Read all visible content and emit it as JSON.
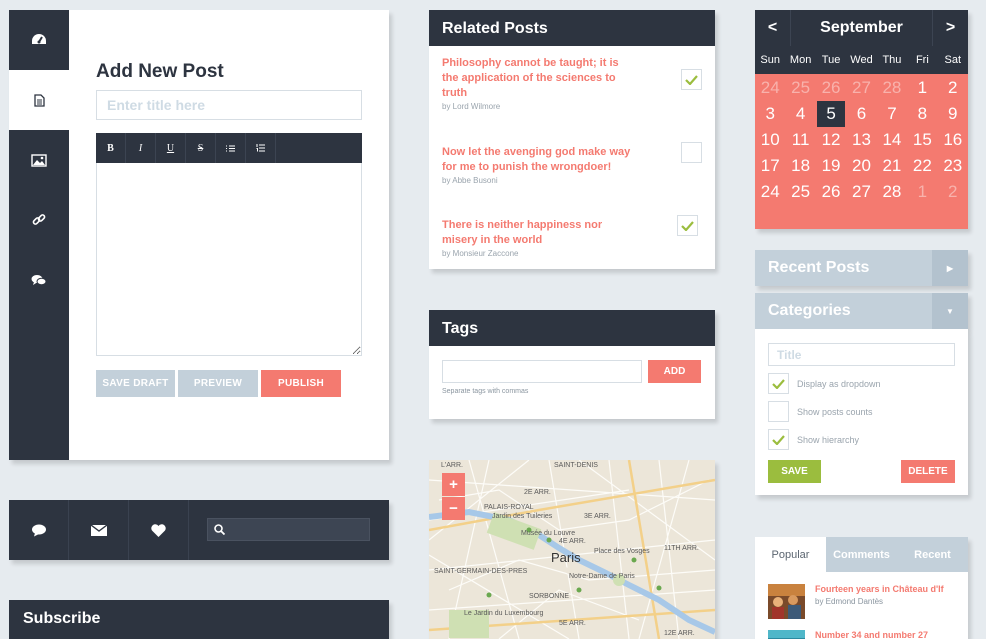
{
  "editor": {
    "title": "Add New Post",
    "title_placeholder": "Enter title here",
    "toolbar": [
      "B",
      "I",
      "U",
      "S",
      "ul",
      "ol"
    ],
    "save_draft": "SAVE DRAFT",
    "preview": "PREVIEW",
    "publish": "PUBLISH",
    "sidebar_icons": [
      "dashboard-icon",
      "document-icon",
      "image-icon",
      "link-icon",
      "comments-icon"
    ]
  },
  "social": {
    "icons": [
      "chat-icon",
      "mail-icon",
      "heart-icon"
    ],
    "search_placeholder": ""
  },
  "subscribe": {
    "title": "Subscribe"
  },
  "related": {
    "title": "Related Posts",
    "items": [
      {
        "title": "Philosophy cannot be taught; it is the application of the sciences to truth",
        "author": "by Lord Wilmore",
        "checked": true
      },
      {
        "title": "Now let the avenging god make way for me to punish the wrongdoer!",
        "author": "by Abbe Busoni",
        "checked": false
      },
      {
        "title": "There is neither happiness nor misery in the world",
        "author": "by Monsieur Zaccone",
        "checked": true
      }
    ]
  },
  "tags": {
    "title": "Tags",
    "add": "ADD",
    "hint": "Separate tags with commas"
  },
  "map": {
    "zoom_in": "+",
    "zoom_out": "−",
    "labels": {
      "paris": "Paris",
      "l1": "L'ARR.",
      "l2": "SAINT-DENIS",
      "l3": "2E ARR.",
      "l4": "PALAIS-ROYAL",
      "l5": "Jardin des Tuileries",
      "l6": "3E ARR.",
      "l7": "Musée du Louvre",
      "l8": "Place des Vosges",
      "l9": "4E ARR.",
      "l10": "11TH ARR.",
      "l11": "SAINT-GERMAIN-DES-PRES",
      "l12": "Notre-Dame de Paris",
      "l13": "SORBONNE",
      "l14": "Le Jardin du Luxembourg",
      "l15": "5E ARR.",
      "l16": "12E ARR."
    }
  },
  "calendar": {
    "prev": "<",
    "next": ">",
    "month": "September",
    "days": [
      "Sun",
      "Mon",
      "Tue",
      "Wed",
      "Thu",
      "Fri",
      "Sat"
    ],
    "cells": [
      {
        "d": "24",
        "m": true
      },
      {
        "d": "25",
        "m": true
      },
      {
        "d": "26",
        "m": true
      },
      {
        "d": "27",
        "m": true
      },
      {
        "d": "28",
        "m": true
      },
      {
        "d": "1"
      },
      {
        "d": "2"
      },
      {
        "d": "3"
      },
      {
        "d": "4"
      },
      {
        "d": "5",
        "t": true
      },
      {
        "d": "6"
      },
      {
        "d": "7"
      },
      {
        "d": "8"
      },
      {
        "d": "9"
      },
      {
        "d": "10"
      },
      {
        "d": "11"
      },
      {
        "d": "12"
      },
      {
        "d": "13"
      },
      {
        "d": "14"
      },
      {
        "d": "15"
      },
      {
        "d": "16"
      },
      {
        "d": "17"
      },
      {
        "d": "18"
      },
      {
        "d": "19"
      },
      {
        "d": "20"
      },
      {
        "d": "21"
      },
      {
        "d": "22"
      },
      {
        "d": "23"
      },
      {
        "d": "24"
      },
      {
        "d": "25"
      },
      {
        "d": "26"
      },
      {
        "d": "27"
      },
      {
        "d": "28"
      },
      {
        "d": "1",
        "m": true
      },
      {
        "d": "2",
        "m": true
      }
    ]
  },
  "recent": {
    "title": "Recent Posts"
  },
  "categories": {
    "title": "Categories",
    "title_placeholder": "Title",
    "options": [
      {
        "label": "Display as dropdown",
        "checked": true
      },
      {
        "label": "Show posts counts",
        "checked": false
      },
      {
        "label": "Show hierarchy",
        "checked": true
      }
    ],
    "save": "SAVE",
    "delete": "DELETE"
  },
  "popular": {
    "tabs": [
      "Popular",
      "Comments",
      "Recent"
    ],
    "items": [
      {
        "title": "Fourteen years in Château d'If",
        "author": "by Edmond Dantès"
      },
      {
        "title": "Number 34 and number 27",
        "author": ""
      }
    ]
  },
  "colors": {
    "dark": "#2d3440",
    "coral": "#f47a70",
    "slate": "#c3d0da",
    "green": "#9bbd3e"
  }
}
